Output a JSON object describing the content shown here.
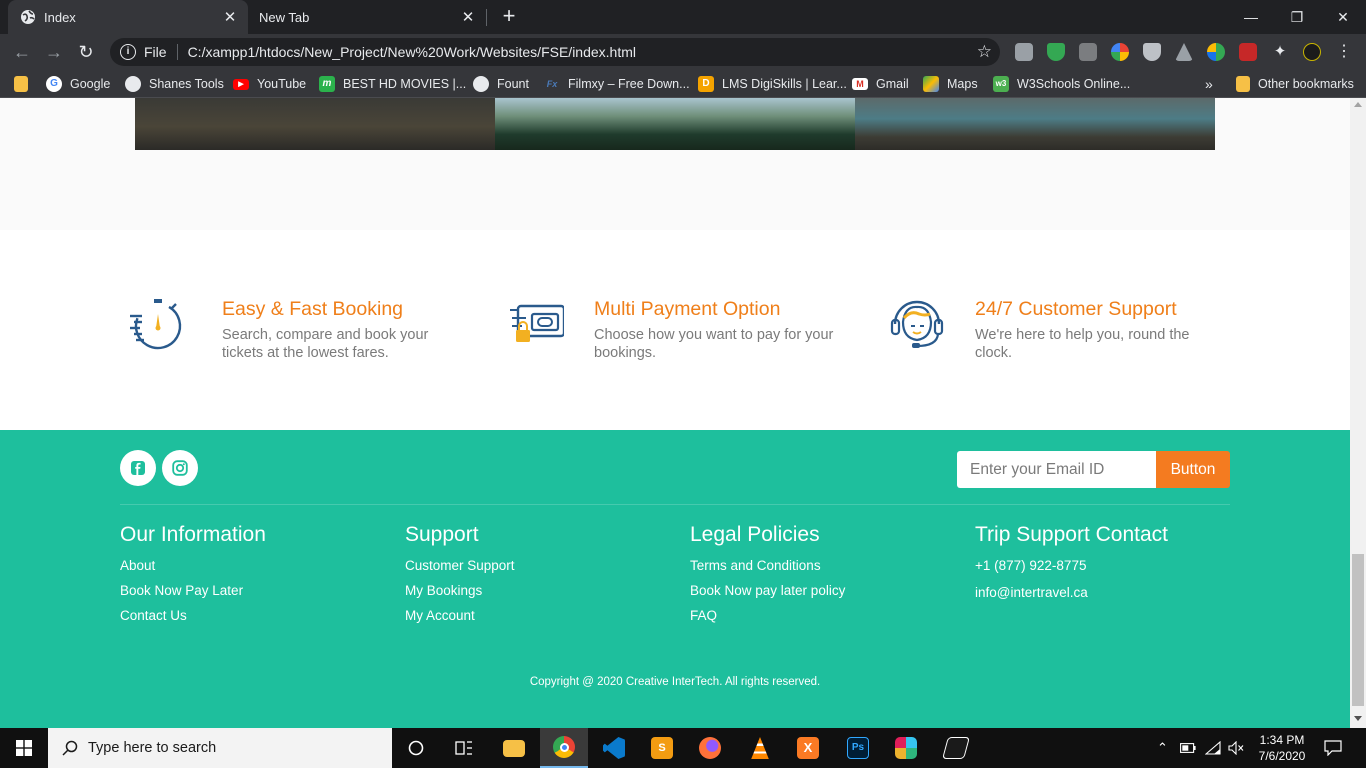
{
  "browser": {
    "tabs": [
      {
        "title": "Index",
        "active": true
      },
      {
        "title": "New Tab",
        "active": false
      }
    ],
    "close_glyph": "✕",
    "new_tab_glyph": "+",
    "window_controls": {
      "minimize": "—",
      "restore": "❐",
      "close": "✕"
    },
    "address": {
      "scheme": "File",
      "url": "C:/xampp1/htdocs/New_Project/New%20Work/Websites/FSE/index.html"
    },
    "bookmarks": [
      {
        "label": "Google",
        "icon": "google-icon",
        "color": "#ffffff"
      },
      {
        "label": "Shanes Tools",
        "icon": "globe-icon",
        "color": "#e8eaed"
      },
      {
        "label": "YouTube",
        "icon": "youtube-icon",
        "color": "#ff0000"
      },
      {
        "label": "BEST HD MOVIES |...",
        "icon": "movies-icon",
        "color": "#2bb24c"
      },
      {
        "label": "Fount",
        "icon": "globe-icon",
        "color": "#e8eaed"
      },
      {
        "label": "Filmxy – Free Down...",
        "icon": "filmxy-icon",
        "color": "#4a7ab8"
      },
      {
        "label": "LMS DigiSkills | Lear...",
        "icon": "digiskills-icon",
        "color": "#f4a300"
      },
      {
        "label": "Gmail",
        "icon": "gmail-icon",
        "color": "#d93025"
      },
      {
        "label": "Maps",
        "icon": "maps-icon",
        "color": "#34a853"
      },
      {
        "label": "W3Schools Online...",
        "icon": "w3schools-icon",
        "color": "#4caf50"
      }
    ],
    "bookmarks_overflow": "»",
    "other_bookmarks": "Other bookmarks"
  },
  "features": [
    {
      "title": "Easy & Fast Booking",
      "desc": "Search, compare and book your tickets at the lowest fares.",
      "icon": "stopwatch-icon"
    },
    {
      "title": "Multi Payment Option",
      "desc": "Choose how you want to pay for your bookings.",
      "icon": "payment-card-icon"
    },
    {
      "title": "24/7 Customer Support",
      "desc": "We're here to help you, round the clock.",
      "icon": "support-agent-icon"
    }
  ],
  "footer": {
    "email_placeholder": "Enter your Email ID",
    "button_label": "Button",
    "columns": [
      {
        "heading": "Our Information",
        "links": [
          "About",
          "Book Now Pay Later",
          "Contact Us"
        ]
      },
      {
        "heading": "Support",
        "links": [
          "Customer Support",
          "My Bookings",
          "My Account"
        ]
      },
      {
        "heading": "Legal Policies",
        "links": [
          "Terms and Conditions",
          "Book Now pay later policy",
          "FAQ"
        ]
      },
      {
        "heading": "Trip Support Contact",
        "links": [
          "+1 (877) 922-8775",
          "info@intertravel.ca"
        ]
      }
    ],
    "copyright": "Copyright @ 2020 Creative InterTech. All rights reserved."
  },
  "taskbar": {
    "search_placeholder": "Type here to search",
    "apps": [
      "cortana-icon",
      "task-view-icon",
      "file-explorer-icon",
      "chrome-icon",
      "vscode-icon",
      "sublime-text-icon",
      "firefox-icon",
      "vlc-icon",
      "xampp-icon",
      "photoshop-icon",
      "slack-icon",
      "game-icon"
    ],
    "time": "1:34 PM",
    "date": "7/6/2020"
  },
  "colors": {
    "accent_orange": "#ef7f1a",
    "footer_teal": "#1ebf9d",
    "button_orange": "#f47b20",
    "icon_blue": "#2a5a8c"
  }
}
